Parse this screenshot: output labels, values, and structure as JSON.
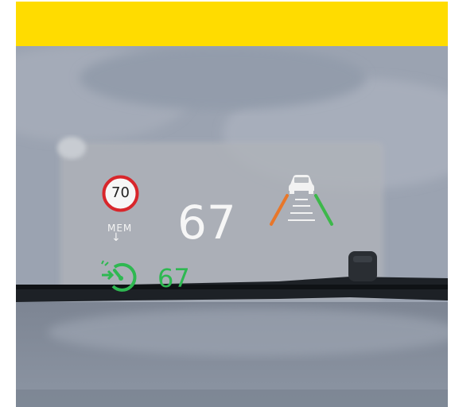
{
  "banner": {
    "color": "#ffdc00"
  },
  "hud": {
    "speed_limit": "70",
    "memory_label": "MEM",
    "memory_arrow": "↓",
    "current_speed": "67",
    "cruise_set_speed": "67",
    "icons": {
      "speed_limit_sign": "speed-limit-sign-icon",
      "lane_assist": "lane-assist-icon",
      "cruise_control": "cruise-control-icon"
    },
    "colors": {
      "sign_ring": "#d8262b",
      "main_text": "#f4f4f4",
      "cruise_green": "#2eb851",
      "lane_left": "#e8772a",
      "lane_right": "#3db84a"
    }
  }
}
